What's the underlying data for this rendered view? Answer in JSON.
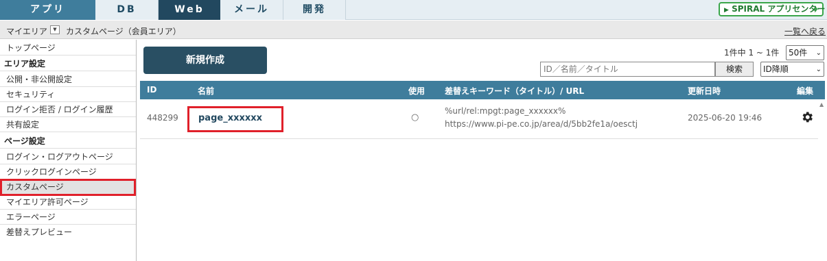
{
  "tabs": [
    {
      "label": "アプリ"
    },
    {
      "label": "DB"
    },
    {
      "label": "Web"
    },
    {
      "label": "メール"
    },
    {
      "label": "開発"
    }
  ],
  "spiral_button": {
    "label": "SPIRAL アプリセンター",
    "icon": "airplane-icon"
  },
  "breadcrumb": {
    "area": "マイエリア",
    "page": "カスタムページ（会員エリア）",
    "back_link": "一覧へ戻る"
  },
  "sidebar": {
    "top": "トップページ",
    "area_settings_head": "エリア設定",
    "area_items": [
      "公開・非公開設定",
      "セキュリティ",
      "ログイン拒否 / ログイン履歴",
      "共有設定"
    ],
    "page_settings_head": "ページ設定",
    "page_items": [
      "ログイン・ログアウトページ",
      "クリックログインページ",
      "カスタムページ",
      "マイエリア許可ページ",
      "エラーページ",
      "差替えプレビュー"
    ]
  },
  "toolbar": {
    "new_button": "新規作成",
    "page_count": "1件中 1 ~ 1件",
    "per_page": "50件",
    "search_placeholder": "ID／名前／タイトル",
    "search_button": "検索",
    "sort": "ID降順"
  },
  "table": {
    "headers": {
      "id": "ID",
      "name": "名前",
      "use": "使用",
      "keyword": "差替えキーワード（タイトル）/ URL",
      "updated": "更新日時",
      "edit": "編集"
    },
    "rows": [
      {
        "id": "448299",
        "name": "page_xxxxxx",
        "use": "○",
        "keyword": "%url/rel:mpgt:page_xxxxxx%",
        "url": "https://www.pi-pe.co.jp/area/d/5bb2fe1a/oesctj",
        "updated": "2025-06-20 19:46",
        "edit_icon": "gear-icon"
      }
    ]
  },
  "colors": {
    "header_blue": "#3f7d9c",
    "dark_navy": "#22485f",
    "highlight_red": "#e0202a",
    "spiral_green": "#3aa64a"
  }
}
